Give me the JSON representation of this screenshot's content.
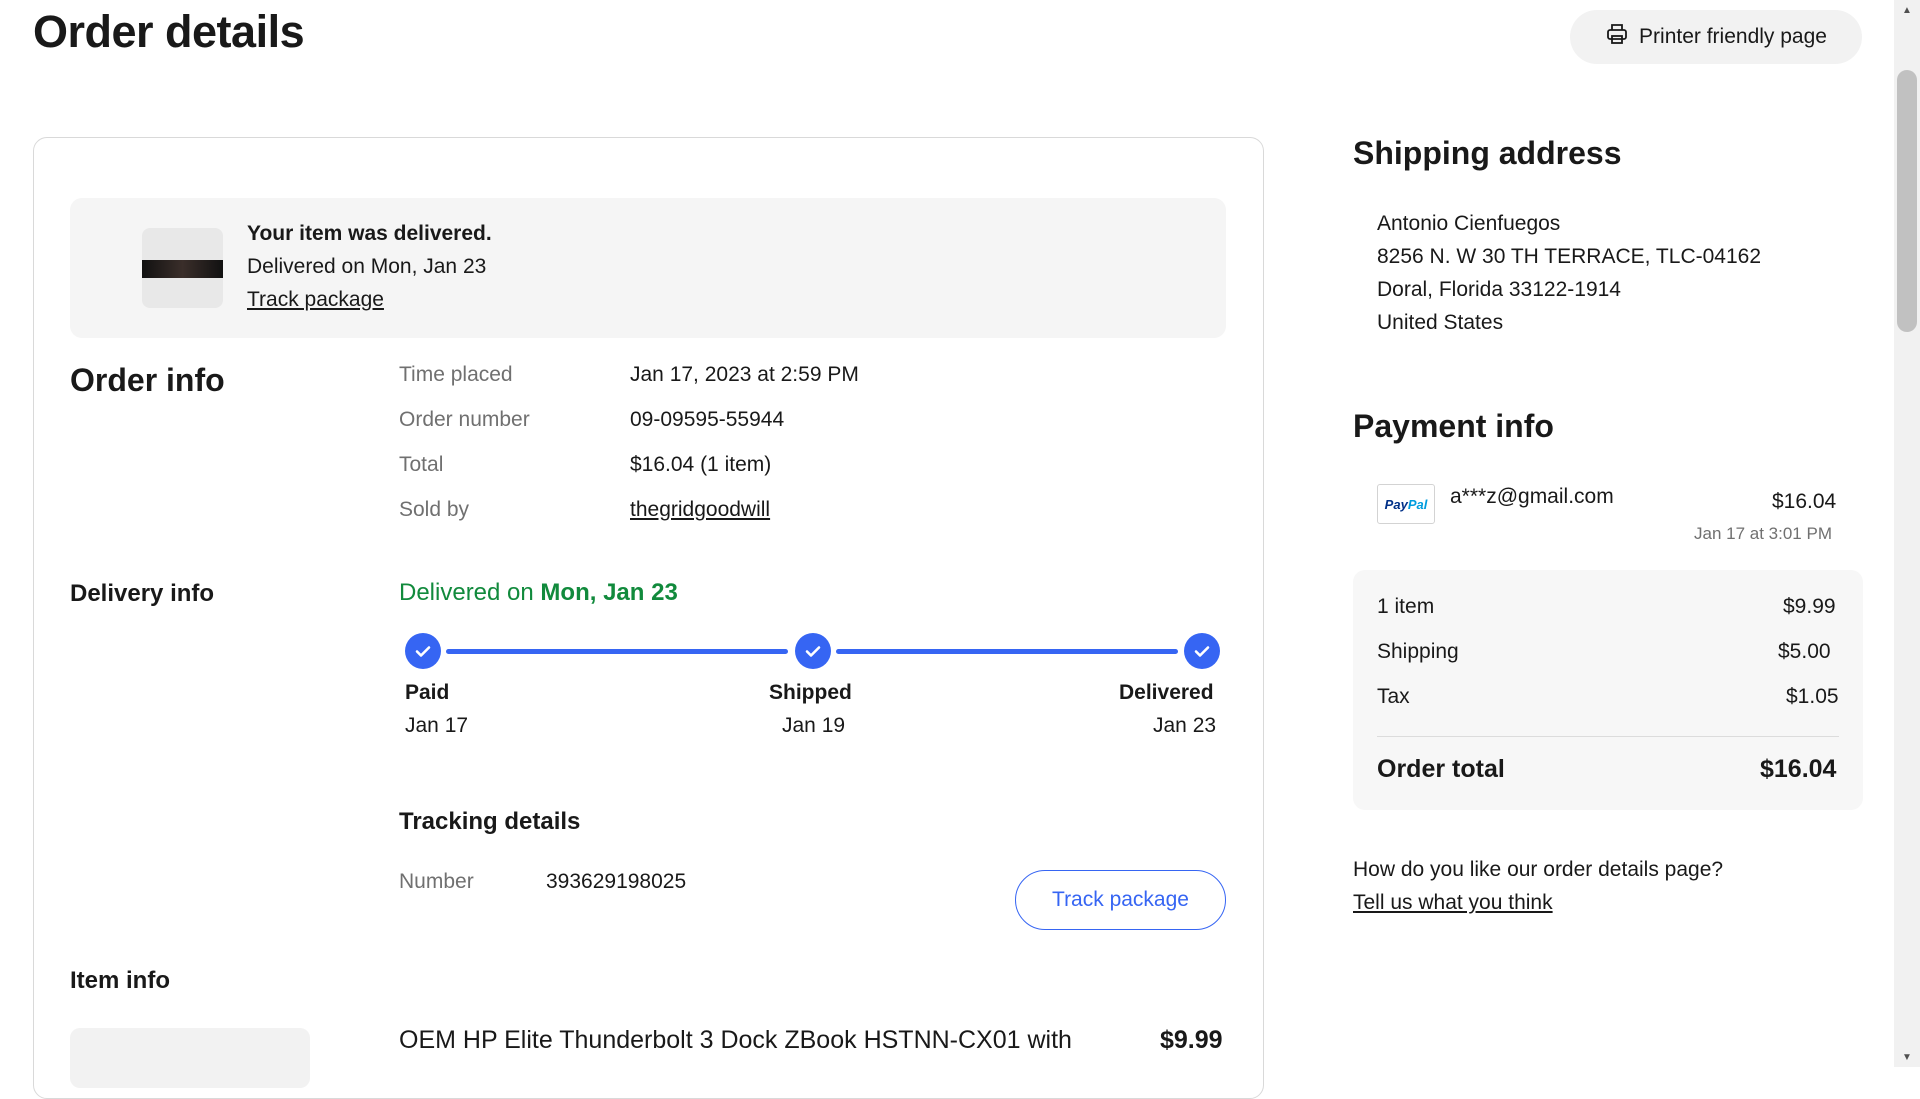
{
  "header": {
    "title": "Order details",
    "print_label": "Printer friendly page",
    "print_icon": "printer-icon"
  },
  "banner": {
    "title": "Your item was delivered.",
    "subtitle": "Delivered on Mon, Jan 23",
    "link": "Track package"
  },
  "order_info": {
    "heading": "Order info",
    "rows": [
      {
        "label": "Time placed",
        "value": "Jan 17, 2023 at 2:59 PM"
      },
      {
        "label": "Order number",
        "value": "09-09595-55944"
      },
      {
        "label": "Total",
        "value": "$16.04 (1 item)"
      },
      {
        "label": "Sold by",
        "value": "thegridgoodwill"
      }
    ]
  },
  "delivery": {
    "heading": "Delivery info",
    "status_prefix": "Delivered on ",
    "status_date": "Mon, Jan 23",
    "steps": [
      {
        "name": "Paid",
        "date": "Jan 17"
      },
      {
        "name": "Shipped",
        "date": "Jan 19"
      },
      {
        "name": "Delivered",
        "date": "Jan 23"
      }
    ],
    "tracking_heading": "Tracking details",
    "number_label": "Number",
    "number_value": "393629198025",
    "track_button": "Track package",
    "accent_color": "#3665f3",
    "status_color": "#118a3c"
  },
  "item_info": {
    "heading": "Item info",
    "title": "OEM HP Elite Thunderbolt 3 Dock ZBook HSTNN-CX01 with",
    "price": "$9.99"
  },
  "shipping": {
    "heading": "Shipping address",
    "lines": [
      "Antonio Cienfuegos",
      "8256 N. W 30 TH TERRACE, TLC-04162",
      "Doral, Florida 33122-1914",
      "United States"
    ]
  },
  "payment": {
    "heading": "Payment info",
    "logo_text_1": "Pay",
    "logo_text_2": "Pal",
    "account": "a***z@gmail.com",
    "amount": "$16.04",
    "date": "Jan 17 at 3:01 PM",
    "rows": [
      {
        "label": "1 item",
        "value": "$9.99"
      },
      {
        "label": "Shipping",
        "value": "$5.00"
      },
      {
        "label": "Tax",
        "value": "$1.05"
      }
    ],
    "total_label": "Order total",
    "total_value": "$16.04"
  },
  "feedback": {
    "question": "How do you like our order details page?",
    "link": "Tell us what you think"
  }
}
